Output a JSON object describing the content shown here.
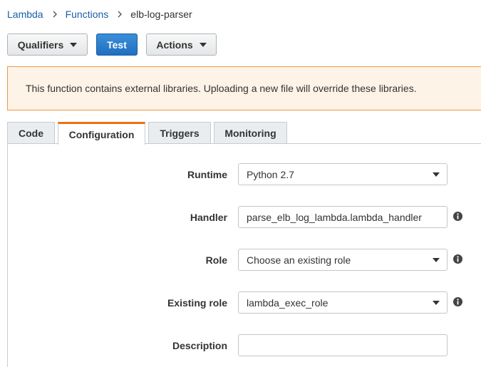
{
  "breadcrumb": {
    "items": [
      "Lambda",
      "Functions"
    ],
    "current": "elb-log-parser"
  },
  "toolbar": {
    "qualifiers_label": "Qualifiers",
    "test_label": "Test",
    "actions_label": "Actions"
  },
  "alert": {
    "message": "This function contains external libraries. Uploading a new file will override these libraries."
  },
  "tabs": [
    {
      "label": "Code",
      "active": false
    },
    {
      "label": "Configuration",
      "active": true
    },
    {
      "label": "Triggers",
      "active": false
    },
    {
      "label": "Monitoring",
      "active": false
    }
  ],
  "form": {
    "runtime": {
      "label": "Runtime",
      "value": "Python 2.7"
    },
    "handler": {
      "label": "Handler",
      "value": "parse_elb_log_lambda.lambda_handler"
    },
    "role": {
      "label": "Role",
      "value": "Choose an existing role"
    },
    "existing_role": {
      "label": "Existing role",
      "value": "lambda_exec_role"
    },
    "description": {
      "label": "Description",
      "value": ""
    }
  },
  "colors": {
    "link": "#1a5fa8",
    "primary_button": "#2a7bcc",
    "alert_background": "#fdf3e7",
    "alert_border": "#ec9a4c",
    "active_tab_accent": "#ec7211"
  },
  "icons": {
    "breadcrumb_separator": "chevron-right-icon",
    "dropdown": "caret-down-icon",
    "info": "info-icon"
  }
}
